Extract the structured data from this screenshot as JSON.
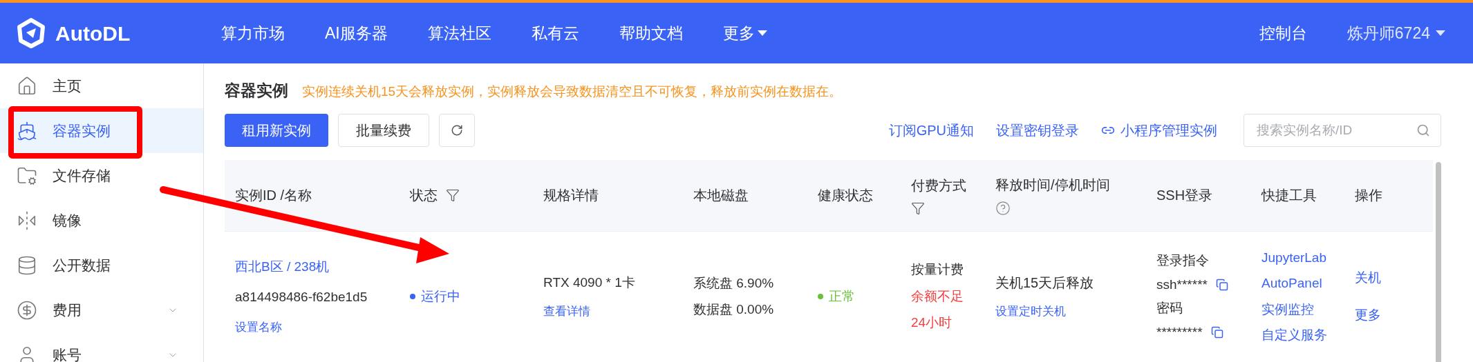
{
  "header": {
    "logo": "AutoDL",
    "nav": [
      {
        "label": "算力市场",
        "dropdown": false
      },
      {
        "label": "AI服务器",
        "dropdown": false
      },
      {
        "label": "算法社区",
        "dropdown": false
      },
      {
        "label": "私有云",
        "dropdown": false
      },
      {
        "label": "帮助文档",
        "dropdown": false
      },
      {
        "label": "更多",
        "dropdown": true
      }
    ],
    "console": "控制台",
    "user": "炼丹师6724"
  },
  "sidebar": {
    "items": [
      {
        "label": "主页",
        "selected": false
      },
      {
        "label": "容器实例",
        "selected": true
      },
      {
        "label": "文件存储",
        "selected": false
      },
      {
        "label": "镜像",
        "selected": false
      },
      {
        "label": "公开数据",
        "selected": false
      },
      {
        "label": "费用",
        "selected": false,
        "expanded": false
      },
      {
        "label": "账号",
        "selected": false,
        "expanded": false
      }
    ]
  },
  "page": {
    "title": "容器实例",
    "notice": "实例连续关机15天会释放实例，实例释放会导致数据清空且不可恢复，释放前实例在数据在。"
  },
  "toolbar": {
    "buttons": [
      {
        "label": "租用新实例",
        "primary": true
      },
      {
        "label": "批量续费",
        "primary": false
      }
    ],
    "links": [
      "订阅GPU通知",
      "设置密钥登录",
      "小程序管理实例"
    ],
    "search": {
      "placeholder": "搜索实例名称/ID"
    }
  },
  "table": {
    "columns": [
      {
        "label": "实例ID /名称",
        "filter": false,
        "help": false
      },
      {
        "label": "状态",
        "filter": true,
        "help": false
      },
      {
        "label": "规格详情",
        "filter": false,
        "help": false
      },
      {
        "label": "本地磁盘",
        "filter": false,
        "help": false
      },
      {
        "label": "健康状态",
        "filter": false,
        "help": false
      },
      {
        "label": "付费方式",
        "filter": true,
        "help": false
      },
      {
        "label": "释放时间/停机时间",
        "filter": false,
        "help": true
      },
      {
        "label": "SSH登录",
        "filter": false,
        "help": false
      },
      {
        "label": "快捷工具",
        "filter": false,
        "help": false
      },
      {
        "label": "操作",
        "filter": false,
        "help": false
      }
    ],
    "rows": [
      {
        "region": "西北B区 / 238机",
        "id": "a814498486-f62be1d5",
        "rename": "设置名称",
        "status": "运行中",
        "spec": "RTX 4090 * 1卡",
        "spec_link": "查看详情",
        "disks": [
          "系统盘 6.90%",
          "数据盘 0.00%"
        ],
        "health": "正常",
        "billing": "按量计费",
        "billing_warning": [
          "余额不足",
          "24小时"
        ],
        "release": "关机15天后释放",
        "release_link": "设置定时关机",
        "ssh": {
          "command_label": "登录指令",
          "command": "ssh******",
          "password_label": "密码",
          "password": "*********"
        },
        "tools": [
          "JupyterLab",
          "AutoPanel",
          "实例监控",
          "自定义服务"
        ],
        "actions": [
          "关机",
          "更多"
        ]
      }
    ]
  }
}
